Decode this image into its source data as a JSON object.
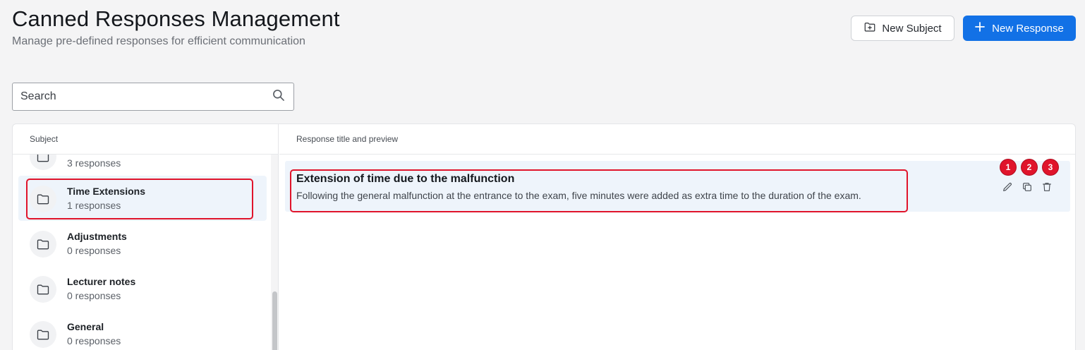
{
  "header": {
    "title": "Canned Responses Management",
    "subtitle": "Manage pre-defined responses for efficient communication",
    "new_subject_label": "New Subject",
    "new_response_label": "New Response"
  },
  "search": {
    "placeholder": "Search",
    "value": ""
  },
  "subjects": {
    "column_header": "Subject",
    "items": [
      {
        "name": "",
        "count": "3 responses"
      },
      {
        "name": "Time Extensions",
        "count": "1 responses",
        "selected": true
      },
      {
        "name": "Adjustments",
        "count": "0 responses"
      },
      {
        "name": "Lecturer notes",
        "count": "0 responses"
      },
      {
        "name": "General",
        "count": "0 responses"
      }
    ]
  },
  "responses": {
    "column_header": "Response title and preview",
    "items": [
      {
        "title": "Extension of time due to the malfunction",
        "preview": "Following the general malfunction at the entrance to the exam, five minutes were added as extra time to the duration of the exam."
      }
    ]
  },
  "annotations": {
    "badges": [
      "1",
      "2",
      "3"
    ]
  },
  "colors": {
    "primary": "#1271e6",
    "highlight": "#e0142b",
    "selected_bg": "#eef4fb"
  },
  "icons": [
    "folder-plus-icon",
    "plus-icon",
    "search-icon",
    "folder-icon",
    "pencil-icon",
    "copy-icon",
    "trash-icon"
  ]
}
